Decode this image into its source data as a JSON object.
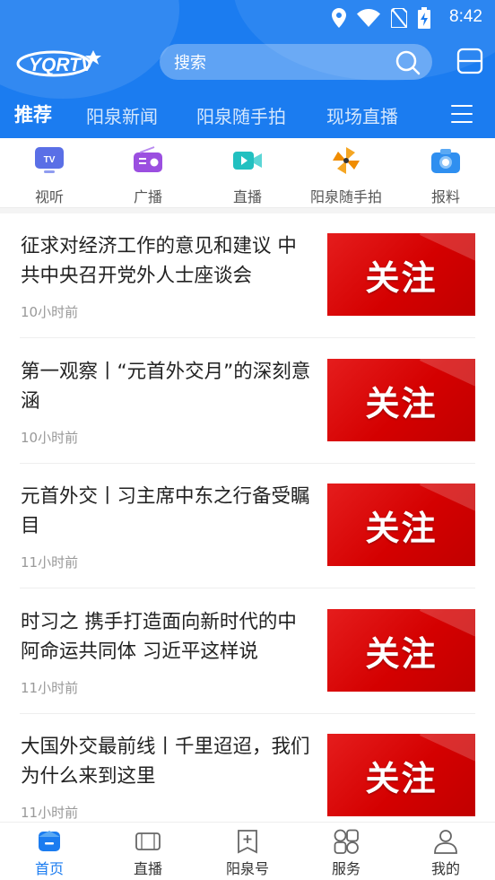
{
  "status_bar": {
    "time": "8:42"
  },
  "header": {
    "logo_text": "YQRTV",
    "search_placeholder": "搜索",
    "tabs": [
      {
        "label": "推荐",
        "active": true
      },
      {
        "label": "阳泉新闻"
      },
      {
        "label": "阳泉随手拍"
      },
      {
        "label": "现场直播"
      }
    ]
  },
  "quick_entries": [
    {
      "label": "视听",
      "icon": "tv-icon"
    },
    {
      "label": "广播",
      "icon": "radio-icon"
    },
    {
      "label": "直播",
      "icon": "video-camera-icon"
    },
    {
      "label": "阳泉随手拍",
      "icon": "pinwheel-icon"
    },
    {
      "label": "报料",
      "icon": "camera-icon"
    }
  ],
  "news": [
    {
      "title": "征求对经济工作的意见和建议 中共中央召开党外人士座谈会",
      "time": "10小时前",
      "thumb_text": "关注"
    },
    {
      "title": "第一观察丨“元首外交月”的深刻意涵",
      "time": "10小时前",
      "thumb_text": "关注"
    },
    {
      "title": "元首外交丨习主席中东之行备受瞩目",
      "time": "11小时前",
      "thumb_text": "关注"
    },
    {
      "title": "时习之 携手打造面向新时代的中阿命运共同体 习近平这样说",
      "time": "11小时前",
      "thumb_text": "关注"
    },
    {
      "title": "大国外交最前线丨千里迢迢，我们为什么来到这里",
      "time": "11小时前",
      "thumb_text": "关注"
    }
  ],
  "bottom_nav": [
    {
      "label": "首页",
      "active": true
    },
    {
      "label": "直播"
    },
    {
      "label": "阳泉号"
    },
    {
      "label": "服务"
    },
    {
      "label": "我的"
    }
  ],
  "colors": {
    "brand_blue": "#1b7cf0",
    "thumb_red": "#d40000"
  }
}
